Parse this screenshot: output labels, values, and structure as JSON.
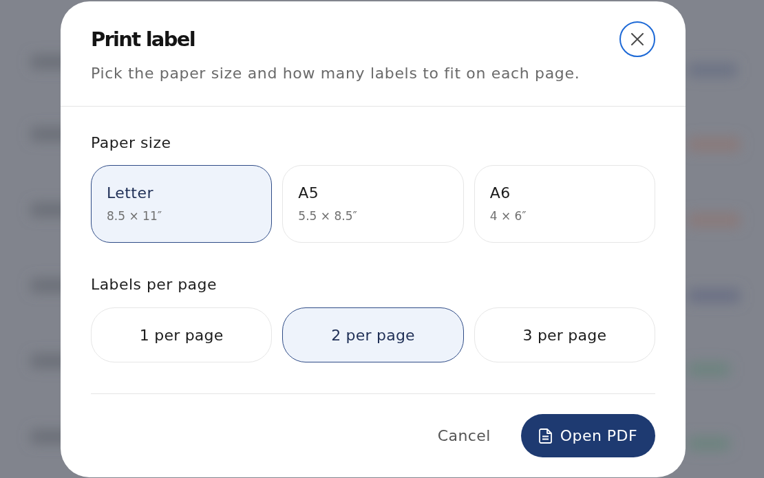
{
  "dialog": {
    "title": "Print label",
    "subtitle": "Pick the paper size and how many labels to fit on each page."
  },
  "paper_size": {
    "label": "Paper size",
    "options": [
      {
        "name": "Letter",
        "size": "8.5 × 11″",
        "selected": true
      },
      {
        "name": "A5",
        "size": "5.5 × 8.5″",
        "selected": false
      },
      {
        "name": "A6",
        "size": "4 × 6″",
        "selected": false
      }
    ]
  },
  "labels_per_page": {
    "label": "Labels per page",
    "options": [
      {
        "name": "1 per page",
        "selected": false
      },
      {
        "name": "2 per page",
        "selected": true
      },
      {
        "name": "3 per page",
        "selected": false
      }
    ]
  },
  "actions": [
    {
      "label": "Cancel",
      "kind": "secondary"
    },
    {
      "label": "Open PDF",
      "kind": "primary"
    }
  ]
}
